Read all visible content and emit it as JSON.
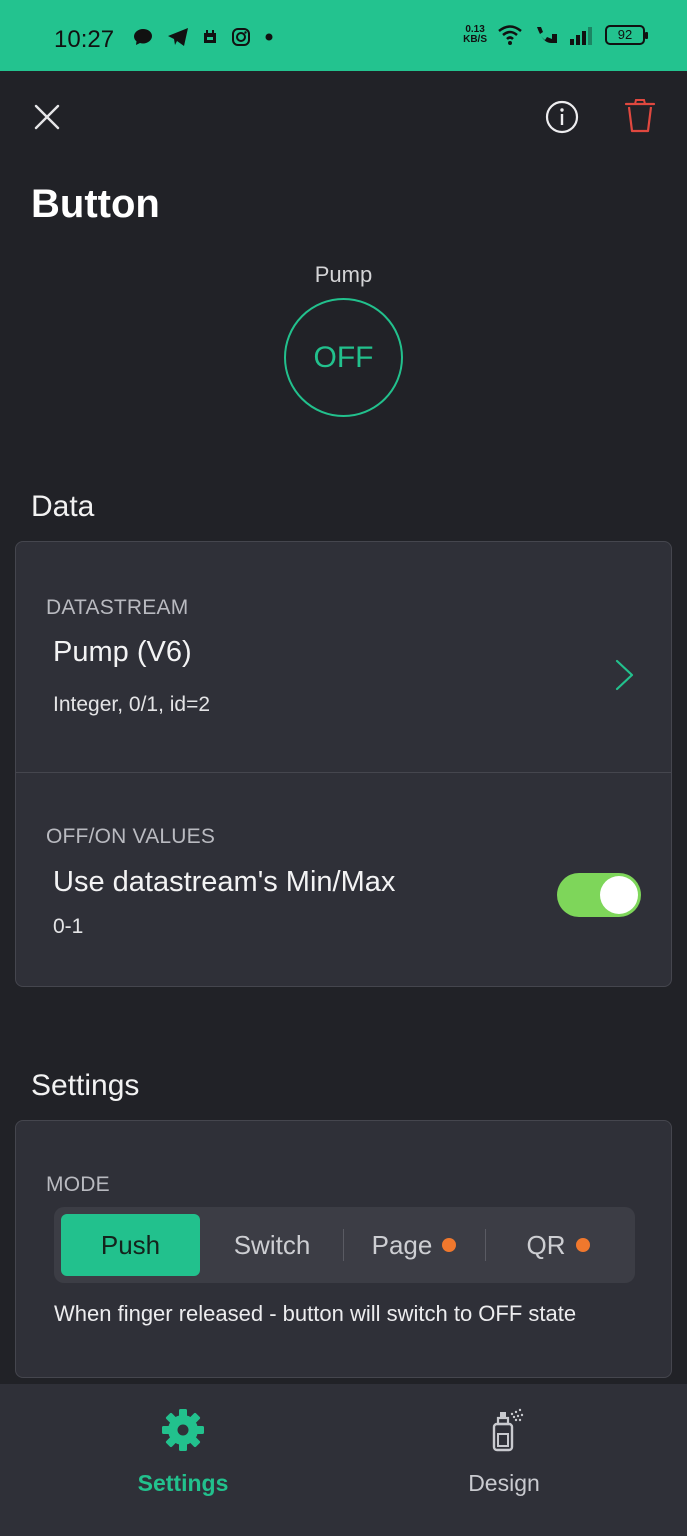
{
  "status_bar": {
    "time": "10:27",
    "net_rate_value": "0.13",
    "net_rate_unit": "KB/S",
    "battery": "92",
    "background_color": "#23c38f"
  },
  "header": {
    "title": "Button",
    "close_icon": "close-icon",
    "info_icon": "info-icon",
    "trash_icon": "trash-icon",
    "trash_color": "#e0483f"
  },
  "preview": {
    "label": "Pump",
    "state": "OFF",
    "accent_color": "#22c18d"
  },
  "data_section": {
    "title": "Data",
    "datastream": {
      "caption": "DATASTREAM",
      "name": "Pump (V6)",
      "details": "Integer, 0/1, id=2"
    },
    "off_on_values": {
      "caption": "OFF/ON VALUES",
      "label": "Use datastream's Min/Max",
      "range": "0-1",
      "toggle_on": true,
      "toggle_color": "#7ed65a"
    }
  },
  "settings_section": {
    "title": "Settings",
    "mode": {
      "caption": "MODE",
      "options": [
        "Push",
        "Switch",
        "Page",
        "QR"
      ],
      "selected": "Push",
      "description": "When finger released - button will switch to OFF state"
    }
  },
  "bottom_nav": {
    "items": [
      {
        "label": "Settings",
        "icon": "gear-icon",
        "active": true
      },
      {
        "label": "Design",
        "icon": "spray-icon",
        "active": false
      }
    ]
  }
}
